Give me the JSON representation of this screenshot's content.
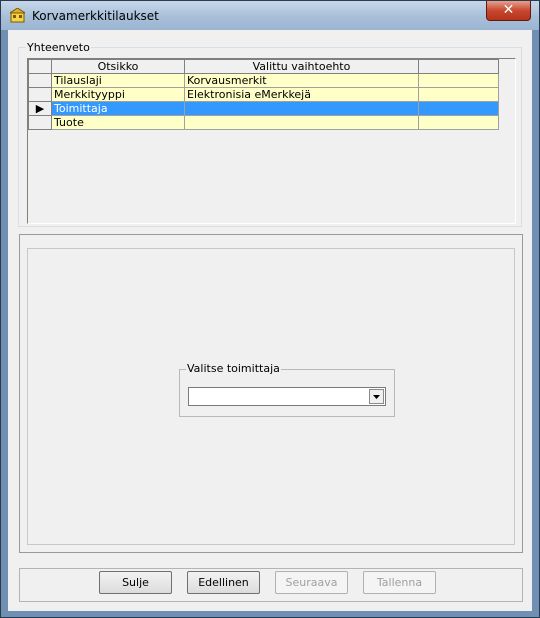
{
  "window": {
    "title": "Korvamerkkitilaukset",
    "close_glyph": "✕"
  },
  "summary": {
    "legend": "Yhteenveto",
    "columns": [
      "Otsikko",
      "Valittu vaihtoehto",
      ""
    ],
    "rows": [
      {
        "indicator": "",
        "title": "Tilauslaji",
        "value": "Korvausmerkit",
        "extra": ""
      },
      {
        "indicator": "",
        "title": "Merkkityyppi",
        "value": "Elektronisia eMerkkejä",
        "extra": ""
      },
      {
        "indicator": "▶",
        "title": "Toimittaja",
        "value": "",
        "extra": "",
        "selected": true
      },
      {
        "indicator": "",
        "title": "Tuote",
        "value": "",
        "extra": ""
      }
    ]
  },
  "supplier": {
    "legend": "Valitse toimittaja",
    "value": ""
  },
  "buttons": {
    "close": "Sulje",
    "previous": "Edellinen",
    "next": "Seuraava",
    "save": "Tallenna"
  }
}
